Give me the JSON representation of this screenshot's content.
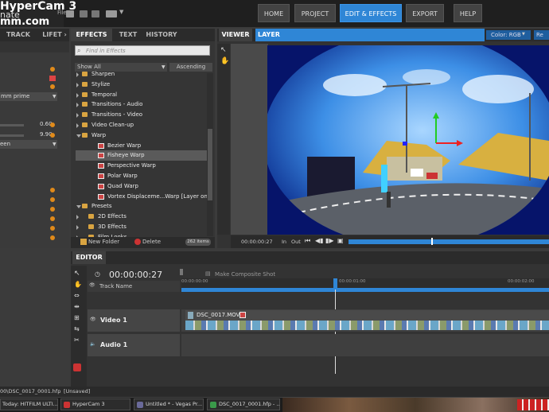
{
  "app": {
    "logo_line1": "HyperCam 3",
    "logo_line2": "nate",
    "logo_line3": "mm.com",
    "file_menu": "File"
  },
  "topnav": [
    "HOME",
    "PROJECT",
    "EDIT & EFFECTS",
    "EXPORT",
    "HELP"
  ],
  "left_panel": {
    "tabs": [
      "TRACK",
      "LIFET ›"
    ],
    "field1": "mm prime",
    "value1": "0.60",
    "value2": "9.90",
    "field2": "een"
  },
  "effects": {
    "tabs": [
      "EFFECTS",
      "TEXT",
      "HISTORY"
    ],
    "search_placeholder": "Find in Effects",
    "filter": "Show All",
    "sort": "Ascending",
    "items": [
      {
        "label": "Sharpen",
        "kind": "folder"
      },
      {
        "label": "Stylize",
        "kind": "folder"
      },
      {
        "label": "Temporal",
        "kind": "folder"
      },
      {
        "label": "Transitions - Audio",
        "kind": "folder"
      },
      {
        "label": "Transitions - Video",
        "kind": "folder"
      },
      {
        "label": "Video Clean-up",
        "kind": "folder"
      },
      {
        "label": "Warp",
        "kind": "folder-open"
      },
      {
        "label": "Bezier Warp",
        "kind": "effect"
      },
      {
        "label": "Fisheye Warp",
        "kind": "effect-selected"
      },
      {
        "label": "Perspective Warp",
        "kind": "effect"
      },
      {
        "label": "Polar Warp",
        "kind": "effect"
      },
      {
        "label": "Quad Warp",
        "kind": "effect"
      },
      {
        "label": "Vortex Displaceme...Warp [Layer only]",
        "kind": "effect"
      },
      {
        "label": "Presets",
        "kind": "folder-open-top"
      },
      {
        "label": "2D Effects",
        "kind": "folder-sub"
      },
      {
        "label": "3D Effects",
        "kind": "folder-sub"
      },
      {
        "label": "Film Looks",
        "kind": "folder-sub"
      }
    ],
    "new_folder": "New Folder",
    "delete": "Delete",
    "count": "262 items"
  },
  "viewer": {
    "tabs": [
      "VIEWER",
      "LAYER"
    ],
    "color": "Color: RGB",
    "res": "Re",
    "timecode": "00:00:00:27",
    "in_label": "In",
    "out_label": "Out"
  },
  "editor": {
    "tab": "EDITOR",
    "timecode": "00:00:00:27",
    "make_composite": "Make Composite Shot",
    "track_name": "Track Name",
    "ruler": [
      "00:00:00:00",
      "00:00:01:00",
      "00:00:02:00"
    ],
    "video_track": "Video 1",
    "audio_track": "Audio 1",
    "clip_name": "DSC_0017.MOV"
  },
  "status": {
    "file": "00\\DSC_0017_0001.hfp",
    "state": "[Unsaved]"
  },
  "taskbar": [
    {
      "label": "Today: HITFILM ULTI...",
      "color": "#3a7fd0"
    },
    {
      "label": "HyperCam 3",
      "color": "#cc3333"
    },
    {
      "label": "Untitled * - Vegas Pr...",
      "color": "#6a6a9a"
    },
    {
      "label": "DSC_0017_0001.hfp - ...",
      "color": "#3a9a4a"
    }
  ]
}
